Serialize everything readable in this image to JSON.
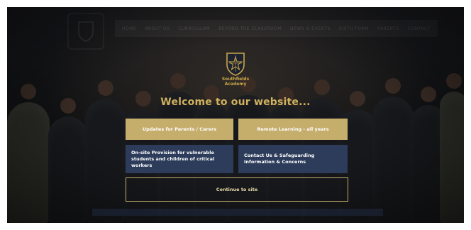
{
  "header": {
    "nav_items": [
      "HOME",
      "ABOUT US",
      "CURRICULUM",
      "BEYOND THE CLASSROOM",
      "NEWS & EVENTS",
      "SIXTH FORM",
      "PARENTS",
      "CONTACT"
    ]
  },
  "modal": {
    "school_name_line1": "Southfields",
    "school_name_line2": "Academy",
    "welcome_text": "Welcome to our website...",
    "tiles": [
      {
        "label": "Updates for Parents / Carers",
        "style": "gold"
      },
      {
        "label": "Remote Learning - all years",
        "style": "gold"
      },
      {
        "label": "On-site Provision for vulnerable students and children of critical workers",
        "style": "navy"
      },
      {
        "label": "Contact Us & Safeguarding Information & Concerns",
        "style": "navy"
      }
    ],
    "continue_label": "Continue to site"
  },
  "colors": {
    "gold": "#c5ad6c",
    "navy": "#2c3c5a",
    "welcome_gold": "#d0b15f"
  },
  "icons": {
    "crest": "school-crest-icon"
  }
}
